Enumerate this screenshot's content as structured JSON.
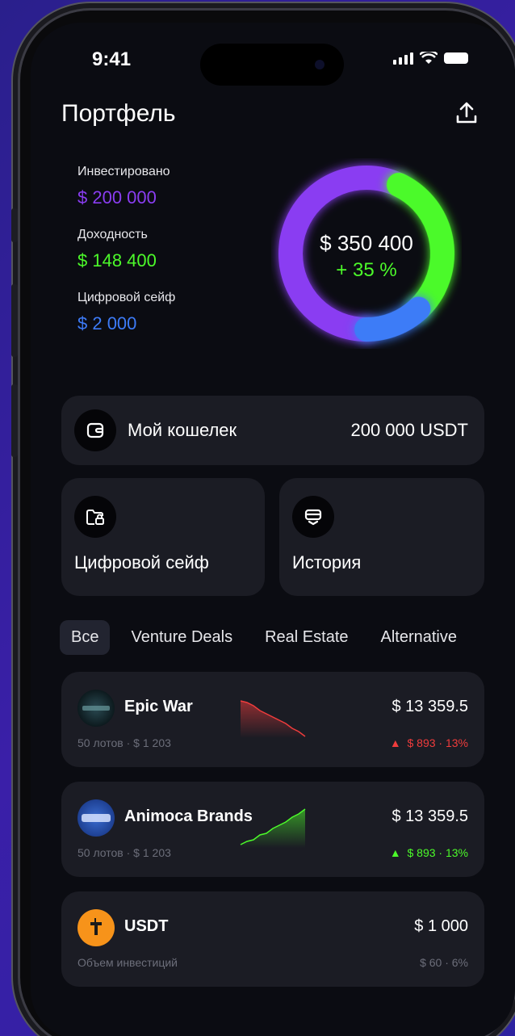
{
  "status": {
    "time": "9:41"
  },
  "header": {
    "title": "Портфель"
  },
  "summary": {
    "invested_label": "Инвестировано",
    "invested_value": "$ 200 000",
    "profit_label": "Доходность",
    "profit_value": "$ 148 400",
    "safe_label": "Цифровой сейф",
    "safe_value": "$ 2 000"
  },
  "donut": {
    "total": "$ 350 400",
    "change": "+ 35 %",
    "segments": [
      {
        "name": "Инвестировано",
        "color": "#8a3df2",
        "fraction": 0.57
      },
      {
        "name": "Доходность",
        "color": "#4cfa2a",
        "fraction": 0.31
      },
      {
        "name": "Цифровой сейф",
        "color": "#3d7bf7",
        "fraction": 0.12
      }
    ]
  },
  "wallet": {
    "label": "Мой кошелек",
    "value": "200 000 USDT",
    "icon": "wallet-icon"
  },
  "tiles": {
    "safe_label": "Цифровой сейф",
    "history_label": "История"
  },
  "tabs": [
    "Все",
    "Venture Deals",
    "Real Estate",
    "Alternative"
  ],
  "assets": [
    {
      "name": "Epic War",
      "price": "$ 13 359.5",
      "sub": "50 лотов · $ 1 203",
      "change": "$ 893 · 13%",
      "trend": "down",
      "color": "#f03c3c"
    },
    {
      "name": "Animoca Brands",
      "price": "$ 13 359.5",
      "sub": "50 лотов · $ 1 203",
      "change": "$ 893 · 13%",
      "trend": "up",
      "color": "#4cfa2a"
    },
    {
      "name": "USDT",
      "price": "$ 1 000",
      "sub": "Объем инвестиций",
      "change": "$ 60 · 6%",
      "trend": "none",
      "color": "#6c6e7a"
    }
  ],
  "colors": {
    "invested": "#8a3df2",
    "profit": "#4cfa2a",
    "safe": "#3d7bf7"
  }
}
